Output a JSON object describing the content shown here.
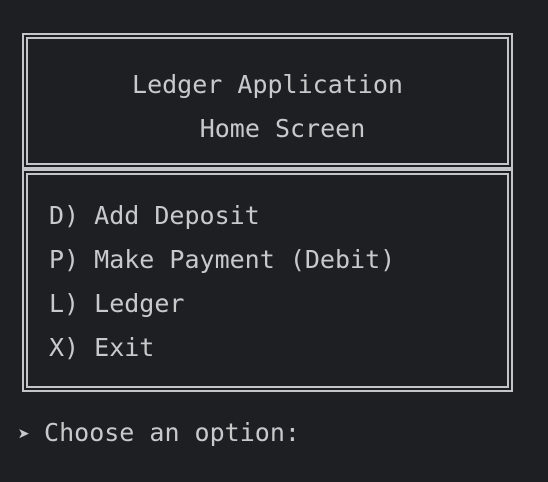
{
  "header": {
    "title": "Ledger Application",
    "subtitle": "Home Screen"
  },
  "menu": {
    "items": [
      {
        "label": "D) Add Deposit"
      },
      {
        "label": "P) Make Payment (Debit)"
      },
      {
        "label": "L) Ledger"
      },
      {
        "label": "X) Exit"
      }
    ]
  },
  "prompt": {
    "arrow": "➤",
    "text": "Choose an option:"
  }
}
